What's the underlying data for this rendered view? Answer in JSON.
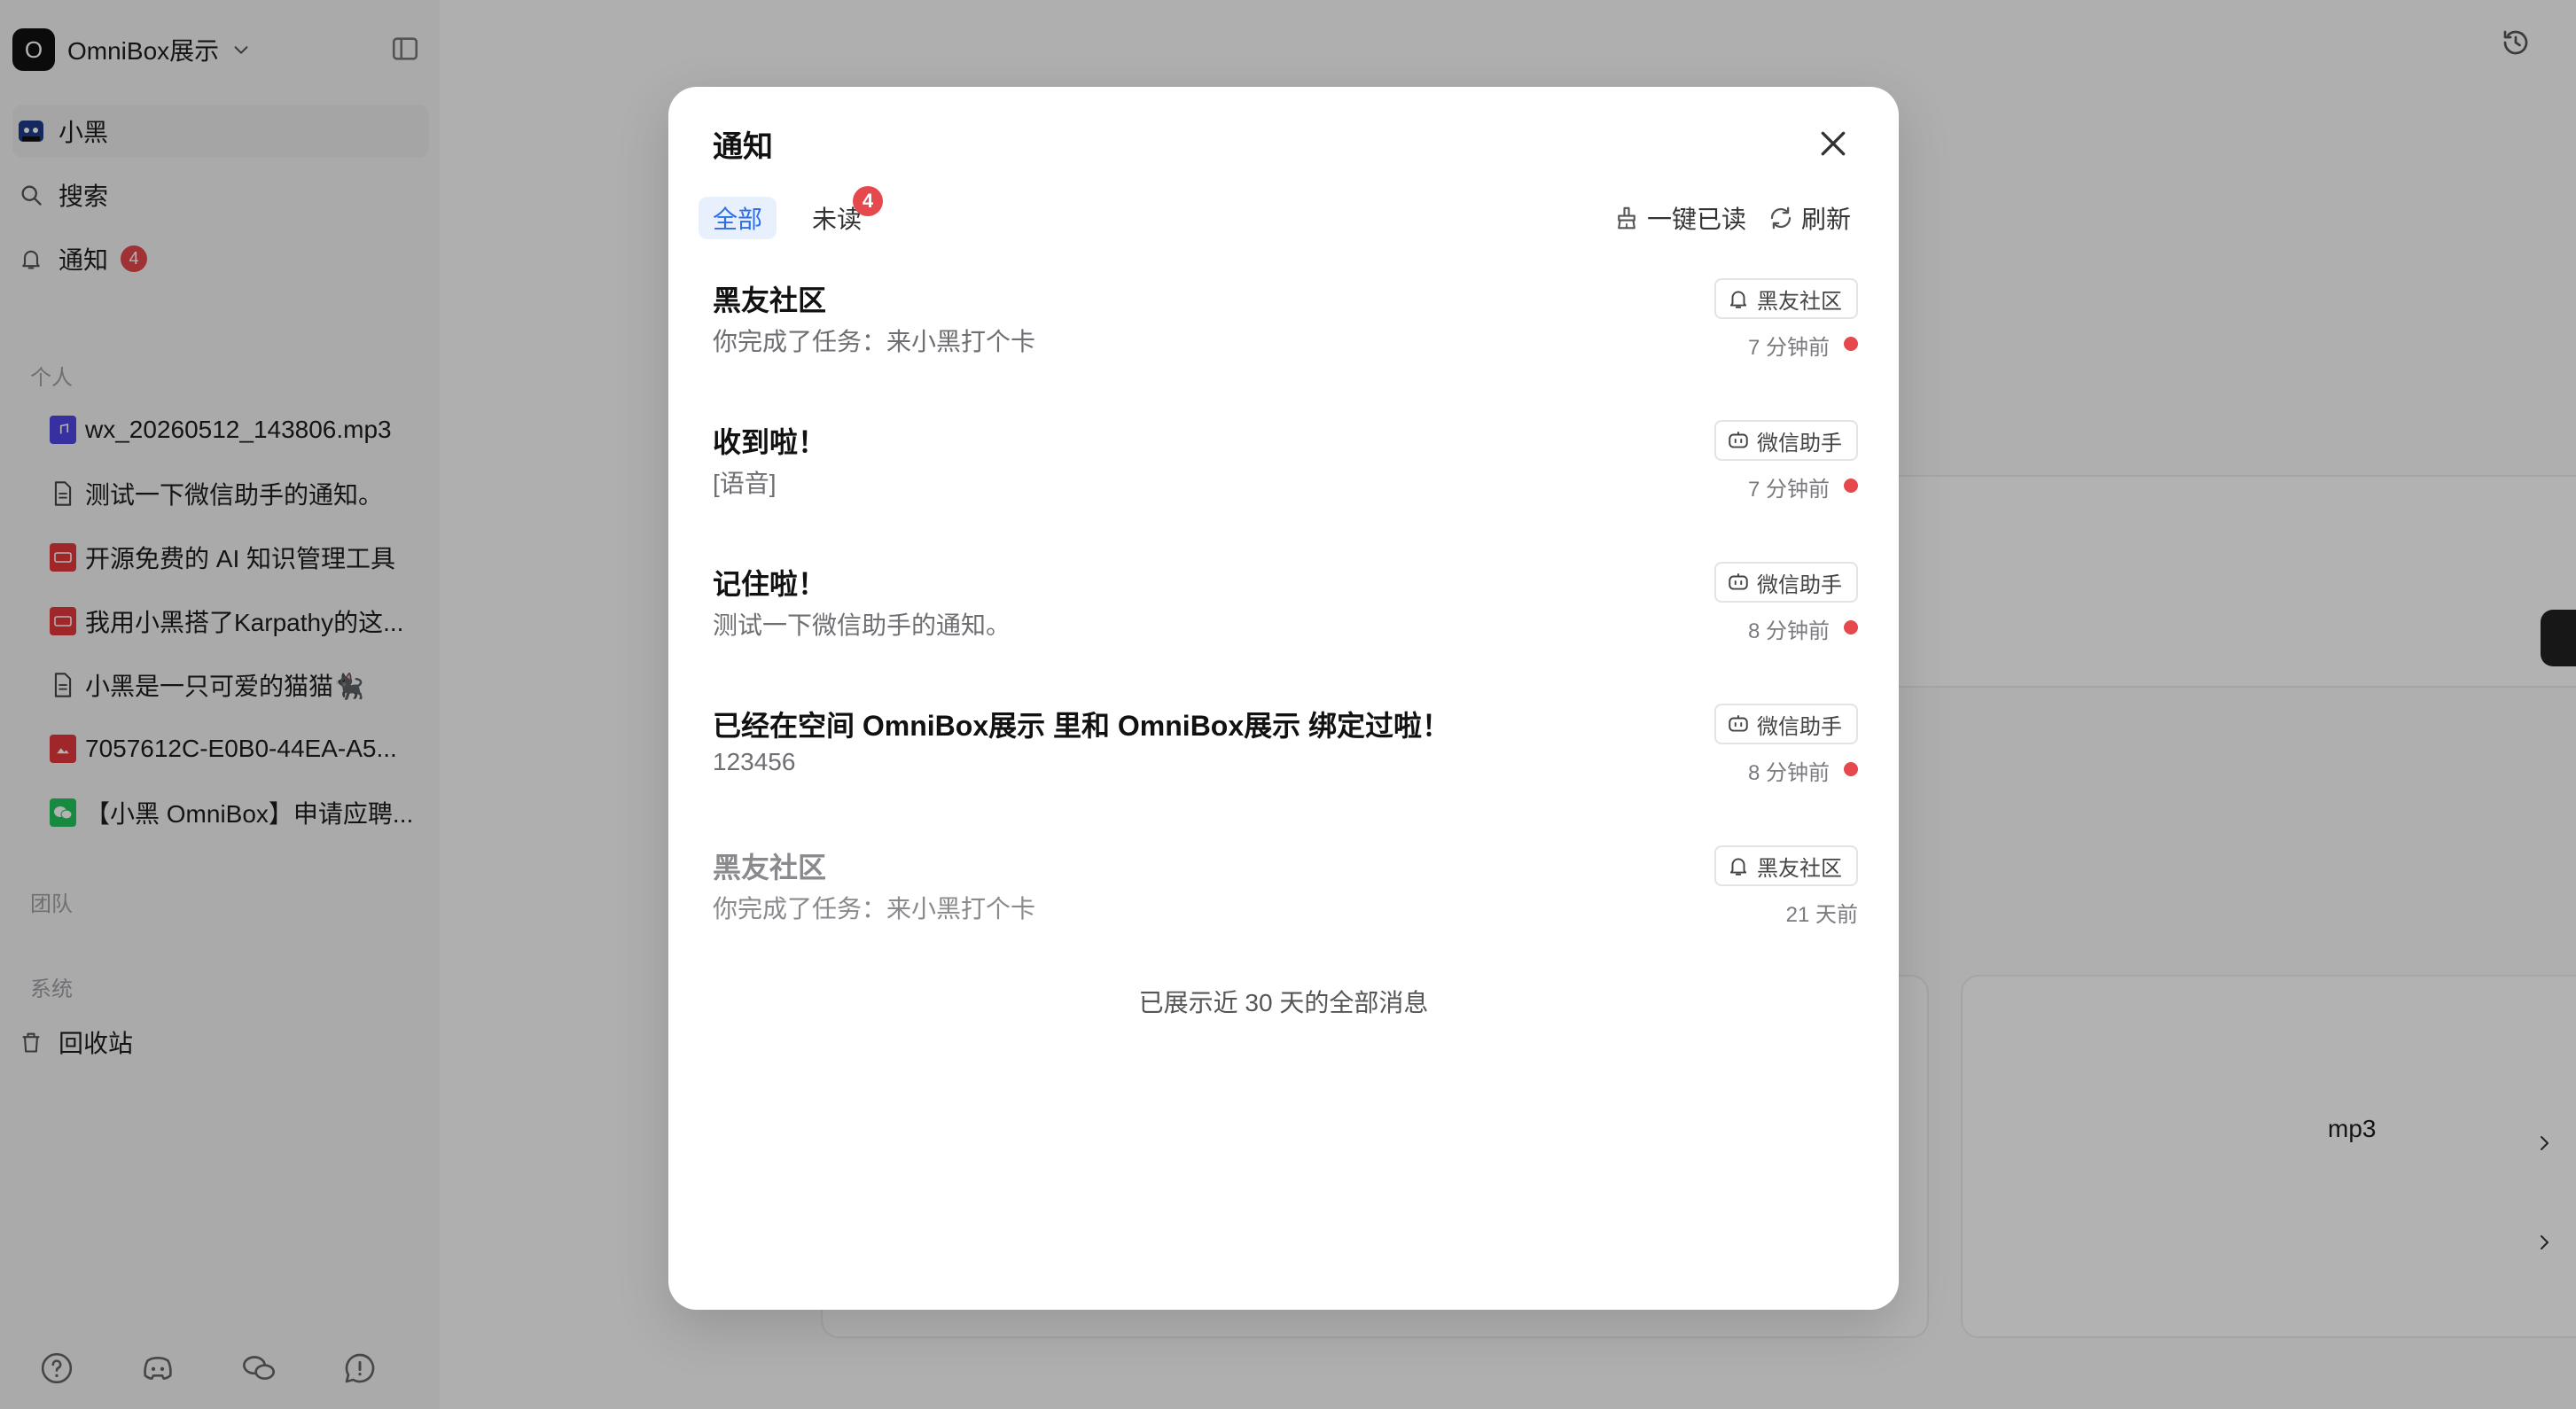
{
  "workspace": {
    "logo_letter": "O",
    "name": "OmniBox展示"
  },
  "sidebar": {
    "nav": [
      {
        "label": "小黑"
      },
      {
        "label": "搜索"
      },
      {
        "label": "通知",
        "badge": "4"
      }
    ],
    "sections": {
      "personal": "个人",
      "team": "团队",
      "system": "系统"
    },
    "docs": [
      {
        "label": "wx_20260512_143806.mp3",
        "icon": "audio-file-icon"
      },
      {
        "label": "测试一下微信助手的通知。",
        "icon": "document-icon"
      },
      {
        "label": "开源免费的 AI 知识管理工具",
        "icon": "video-file-icon"
      },
      {
        "label": "我用小黑搭了Karpathy的这...",
        "icon": "video-file-icon"
      },
      {
        "label": "小黑是一只可爱的猫猫🐈‍⬛",
        "icon": "document-icon"
      },
      {
        "label": "7057612C-E0B0-44EA-A5...",
        "icon": "image-file-icon"
      },
      {
        "label": "【小黑 OmniBox】申请应聘...",
        "icon": "wechat-icon"
      }
    ],
    "trash": "回收站"
  },
  "background": {
    "partial_text": "mp3"
  },
  "modal": {
    "title": "通知",
    "tabs": {
      "all": "全部",
      "unread": "未读",
      "unread_count": "4"
    },
    "actions": {
      "mark_all_read": "一键已读",
      "refresh": "刷新"
    },
    "notifications": [
      {
        "title": "黑友社区",
        "body": "你完成了任务：来小黑打个卡",
        "source": "黑友社区",
        "source_icon": "bell-icon",
        "time": "7 分钟前",
        "unread": true
      },
      {
        "title": "收到啦！",
        "body": "[语音]",
        "source": "微信助手",
        "source_icon": "bot-icon",
        "time": "7 分钟前",
        "unread": true
      },
      {
        "title": "记住啦！",
        "body": "测试一下微信助手的通知。",
        "source": "微信助手",
        "source_icon": "bot-icon",
        "time": "8 分钟前",
        "unread": true
      },
      {
        "title": "已经在空间 OmniBox展示 里和 OmniBox展示 绑定过啦！",
        "body": "123456",
        "source": "微信助手",
        "source_icon": "bot-icon",
        "time": "8 分钟前",
        "unread": true
      },
      {
        "title": "黑友社区",
        "body": "你完成了任务：来小黑打个卡",
        "source": "黑友社区",
        "source_icon": "bell-icon",
        "time": "21 天前",
        "unread": false
      }
    ],
    "footer": "已展示近 30 天的全部消息"
  }
}
